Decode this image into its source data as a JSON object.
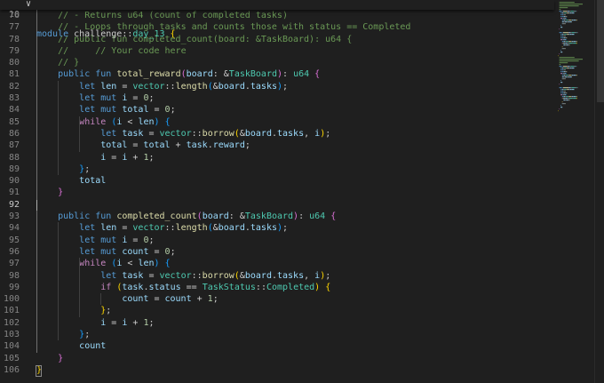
{
  "sticky_scroll": {
    "line_number": "10",
    "tokens": [
      {
        "t": "module",
        "c": "kw"
      },
      {
        "t": " challenge",
        "c": "p"
      },
      {
        "t": "::",
        "c": "p"
      },
      {
        "t": "day_13",
        "c": "ty"
      },
      {
        "t": " ",
        "c": "p"
      },
      {
        "t": "{",
        "c": "b1"
      }
    ]
  },
  "lines": [
    {
      "n": "76",
      "i": 1,
      "tokens": [
        {
          "t": "// - Returns u64 (count of completed tasks)",
          "c": "com"
        }
      ]
    },
    {
      "n": "77",
      "i": 1,
      "tokens": [
        {
          "t": "// - Loops through tasks and counts those with status == Completed",
          "c": "com"
        }
      ]
    },
    {
      "n": "78",
      "i": 1,
      "tokens": [
        {
          "t": "// public fun completed_count(board: &TaskBoard): u64 {",
          "c": "com"
        }
      ]
    },
    {
      "n": "79",
      "i": 1,
      "tokens": [
        {
          "t": "//     // Your code here",
          "c": "com"
        }
      ]
    },
    {
      "n": "80",
      "i": 1,
      "tokens": [
        {
          "t": "// }",
          "c": "com"
        }
      ]
    },
    {
      "n": "81",
      "i": 1,
      "tokens": [
        {
          "t": "public",
          "c": "kw"
        },
        {
          "t": " ",
          "c": "p"
        },
        {
          "t": "fun",
          "c": "kw"
        },
        {
          "t": " ",
          "c": "p"
        },
        {
          "t": "total_reward",
          "c": "fn"
        },
        {
          "t": "(",
          "c": "b2"
        },
        {
          "t": "board",
          "c": "var"
        },
        {
          "t": ": &",
          "c": "p"
        },
        {
          "t": "TaskBoard",
          "c": "ty"
        },
        {
          "t": ")",
          "c": "b2"
        },
        {
          "t": ": ",
          "c": "p"
        },
        {
          "t": "u64",
          "c": "ty"
        },
        {
          "t": " ",
          "c": "p"
        },
        {
          "t": "{",
          "c": "b2"
        }
      ]
    },
    {
      "n": "82",
      "i": 2,
      "tokens": [
        {
          "t": "let",
          "c": "kw"
        },
        {
          "t": " ",
          "c": "p"
        },
        {
          "t": "len",
          "c": "var"
        },
        {
          "t": " = ",
          "c": "p"
        },
        {
          "t": "vector",
          "c": "ty"
        },
        {
          "t": "::",
          "c": "p"
        },
        {
          "t": "length",
          "c": "fn"
        },
        {
          "t": "(",
          "c": "b3"
        },
        {
          "t": "&",
          "c": "p"
        },
        {
          "t": "board",
          "c": "var"
        },
        {
          "t": ".",
          "c": "p"
        },
        {
          "t": "tasks",
          "c": "var"
        },
        {
          "t": ")",
          "c": "b3"
        },
        {
          "t": ";",
          "c": "p"
        }
      ]
    },
    {
      "n": "83",
      "i": 2,
      "tokens": [
        {
          "t": "let",
          "c": "kw"
        },
        {
          "t": " ",
          "c": "p"
        },
        {
          "t": "mut",
          "c": "kw"
        },
        {
          "t": " ",
          "c": "p"
        },
        {
          "t": "i",
          "c": "var"
        },
        {
          "t": " = ",
          "c": "p"
        },
        {
          "t": "0",
          "c": "num"
        },
        {
          "t": ";",
          "c": "p"
        }
      ]
    },
    {
      "n": "84",
      "i": 2,
      "tokens": [
        {
          "t": "let",
          "c": "kw"
        },
        {
          "t": " ",
          "c": "p"
        },
        {
          "t": "mut",
          "c": "kw"
        },
        {
          "t": " ",
          "c": "p"
        },
        {
          "t": "total",
          "c": "var"
        },
        {
          "t": " = ",
          "c": "p"
        },
        {
          "t": "0",
          "c": "num"
        },
        {
          "t": ";",
          "c": "p"
        }
      ]
    },
    {
      "n": "85",
      "i": 2,
      "tokens": [
        {
          "t": "while",
          "c": "kw-ctrl"
        },
        {
          "t": " ",
          "c": "p"
        },
        {
          "t": "(",
          "c": "b3"
        },
        {
          "t": "i",
          "c": "var"
        },
        {
          "t": " < ",
          "c": "p"
        },
        {
          "t": "len",
          "c": "var"
        },
        {
          "t": ")",
          "c": "b3"
        },
        {
          "t": " ",
          "c": "p"
        },
        {
          "t": "{",
          "c": "b3"
        }
      ]
    },
    {
      "n": "86",
      "i": 3,
      "tokens": [
        {
          "t": "let",
          "c": "kw"
        },
        {
          "t": " ",
          "c": "p"
        },
        {
          "t": "task",
          "c": "var"
        },
        {
          "t": " = ",
          "c": "p"
        },
        {
          "t": "vector",
          "c": "ty"
        },
        {
          "t": "::",
          "c": "p"
        },
        {
          "t": "borrow",
          "c": "fn"
        },
        {
          "t": "(",
          "c": "b1"
        },
        {
          "t": "&",
          "c": "p"
        },
        {
          "t": "board",
          "c": "var"
        },
        {
          "t": ".",
          "c": "p"
        },
        {
          "t": "tasks",
          "c": "var"
        },
        {
          "t": ", ",
          "c": "p"
        },
        {
          "t": "i",
          "c": "var"
        },
        {
          "t": ")",
          "c": "b1"
        },
        {
          "t": ";",
          "c": "p"
        }
      ]
    },
    {
      "n": "87",
      "i": 3,
      "tokens": [
        {
          "t": "total",
          "c": "var"
        },
        {
          "t": " = ",
          "c": "p"
        },
        {
          "t": "total",
          "c": "var"
        },
        {
          "t": " + ",
          "c": "p"
        },
        {
          "t": "task",
          "c": "var"
        },
        {
          "t": ".",
          "c": "p"
        },
        {
          "t": "reward",
          "c": "var"
        },
        {
          "t": ";",
          "c": "p"
        }
      ]
    },
    {
      "n": "88",
      "i": 3,
      "tokens": [
        {
          "t": "i",
          "c": "var"
        },
        {
          "t": " = ",
          "c": "p"
        },
        {
          "t": "i",
          "c": "var"
        },
        {
          "t": " + ",
          "c": "p"
        },
        {
          "t": "1",
          "c": "num"
        },
        {
          "t": ";",
          "c": "p"
        }
      ]
    },
    {
      "n": "89",
      "i": 2,
      "tokens": [
        {
          "t": "}",
          "c": "b3"
        },
        {
          "t": ";",
          "c": "p"
        }
      ]
    },
    {
      "n": "90",
      "i": 2,
      "tokens": [
        {
          "t": "total",
          "c": "var"
        }
      ]
    },
    {
      "n": "91",
      "i": 1,
      "tokens": [
        {
          "t": "}",
          "c": "b2"
        }
      ]
    },
    {
      "n": "92",
      "i": 0,
      "current": true,
      "tokens": []
    },
    {
      "n": "93",
      "i": 1,
      "tokens": [
        {
          "t": "public",
          "c": "kw"
        },
        {
          "t": " ",
          "c": "p"
        },
        {
          "t": "fun",
          "c": "kw"
        },
        {
          "t": " ",
          "c": "p"
        },
        {
          "t": "completed_count",
          "c": "fn"
        },
        {
          "t": "(",
          "c": "b2"
        },
        {
          "t": "board",
          "c": "var"
        },
        {
          "t": ": &",
          "c": "p"
        },
        {
          "t": "TaskBoard",
          "c": "ty"
        },
        {
          "t": ")",
          "c": "b2"
        },
        {
          "t": ": ",
          "c": "p"
        },
        {
          "t": "u64",
          "c": "ty"
        },
        {
          "t": " ",
          "c": "p"
        },
        {
          "t": "{",
          "c": "b2"
        }
      ]
    },
    {
      "n": "94",
      "i": 2,
      "tokens": [
        {
          "t": "let",
          "c": "kw"
        },
        {
          "t": " ",
          "c": "p"
        },
        {
          "t": "len",
          "c": "var"
        },
        {
          "t": " = ",
          "c": "p"
        },
        {
          "t": "vector",
          "c": "ty"
        },
        {
          "t": "::",
          "c": "p"
        },
        {
          "t": "length",
          "c": "fn"
        },
        {
          "t": "(",
          "c": "b3"
        },
        {
          "t": "&",
          "c": "p"
        },
        {
          "t": "board",
          "c": "var"
        },
        {
          "t": ".",
          "c": "p"
        },
        {
          "t": "tasks",
          "c": "var"
        },
        {
          "t": ")",
          "c": "b3"
        },
        {
          "t": ";",
          "c": "p"
        }
      ]
    },
    {
      "n": "95",
      "i": 2,
      "tokens": [
        {
          "t": "let",
          "c": "kw"
        },
        {
          "t": " ",
          "c": "p"
        },
        {
          "t": "mut",
          "c": "kw"
        },
        {
          "t": " ",
          "c": "p"
        },
        {
          "t": "i",
          "c": "var"
        },
        {
          "t": " = ",
          "c": "p"
        },
        {
          "t": "0",
          "c": "num"
        },
        {
          "t": ";",
          "c": "p"
        }
      ]
    },
    {
      "n": "96",
      "i": 2,
      "tokens": [
        {
          "t": "let",
          "c": "kw"
        },
        {
          "t": " ",
          "c": "p"
        },
        {
          "t": "mut",
          "c": "kw"
        },
        {
          "t": " ",
          "c": "p"
        },
        {
          "t": "count",
          "c": "var"
        },
        {
          "t": " = ",
          "c": "p"
        },
        {
          "t": "0",
          "c": "num"
        },
        {
          "t": ";",
          "c": "p"
        }
      ]
    },
    {
      "n": "97",
      "i": 2,
      "tokens": [
        {
          "t": "while",
          "c": "kw-ctrl"
        },
        {
          "t": " ",
          "c": "p"
        },
        {
          "t": "(",
          "c": "b3"
        },
        {
          "t": "i",
          "c": "var"
        },
        {
          "t": " < ",
          "c": "p"
        },
        {
          "t": "len",
          "c": "var"
        },
        {
          "t": ")",
          "c": "b3"
        },
        {
          "t": " ",
          "c": "p"
        },
        {
          "t": "{",
          "c": "b3"
        }
      ]
    },
    {
      "n": "98",
      "i": 3,
      "tokens": [
        {
          "t": "let",
          "c": "kw"
        },
        {
          "t": " ",
          "c": "p"
        },
        {
          "t": "task",
          "c": "var"
        },
        {
          "t": " = ",
          "c": "p"
        },
        {
          "t": "vector",
          "c": "ty"
        },
        {
          "t": "::",
          "c": "p"
        },
        {
          "t": "borrow",
          "c": "fn"
        },
        {
          "t": "(",
          "c": "b1"
        },
        {
          "t": "&",
          "c": "p"
        },
        {
          "t": "board",
          "c": "var"
        },
        {
          "t": ".",
          "c": "p"
        },
        {
          "t": "tasks",
          "c": "var"
        },
        {
          "t": ", ",
          "c": "p"
        },
        {
          "t": "i",
          "c": "var"
        },
        {
          "t": ")",
          "c": "b1"
        },
        {
          "t": ";",
          "c": "p"
        }
      ]
    },
    {
      "n": "99",
      "i": 3,
      "tokens": [
        {
          "t": "if",
          "c": "kw-ctrl"
        },
        {
          "t": " ",
          "c": "p"
        },
        {
          "t": "(",
          "c": "b1"
        },
        {
          "t": "task",
          "c": "var"
        },
        {
          "t": ".",
          "c": "p"
        },
        {
          "t": "status",
          "c": "var"
        },
        {
          "t": " == ",
          "c": "p"
        },
        {
          "t": "TaskStatus",
          "c": "ty"
        },
        {
          "t": "::",
          "c": "p"
        },
        {
          "t": "Completed",
          "c": "ty"
        },
        {
          "t": ")",
          "c": "b1"
        },
        {
          "t": " ",
          "c": "p"
        },
        {
          "t": "{",
          "c": "b1"
        }
      ]
    },
    {
      "n": "100",
      "i": 4,
      "tokens": [
        {
          "t": "count",
          "c": "var"
        },
        {
          "t": " = ",
          "c": "p"
        },
        {
          "t": "count",
          "c": "var"
        },
        {
          "t": " + ",
          "c": "p"
        },
        {
          "t": "1",
          "c": "num"
        },
        {
          "t": ";",
          "c": "p"
        }
      ]
    },
    {
      "n": "101",
      "i": 3,
      "tokens": [
        {
          "t": "}",
          "c": "b1"
        },
        {
          "t": ";",
          "c": "p"
        }
      ]
    },
    {
      "n": "102",
      "i": 3,
      "tokens": [
        {
          "t": "i",
          "c": "var"
        },
        {
          "t": " = ",
          "c": "p"
        },
        {
          "t": "i",
          "c": "var"
        },
        {
          "t": " + ",
          "c": "p"
        },
        {
          "t": "1",
          "c": "num"
        },
        {
          "t": ";",
          "c": "p"
        }
      ]
    },
    {
      "n": "103",
      "i": 2,
      "tokens": [
        {
          "t": "}",
          "c": "b3"
        },
        {
          "t": ";",
          "c": "p"
        }
      ]
    },
    {
      "n": "104",
      "i": 2,
      "tokens": [
        {
          "t": "count",
          "c": "var"
        }
      ]
    },
    {
      "n": "105",
      "i": 1,
      "tokens": [
        {
          "t": "}",
          "c": "b2"
        }
      ]
    },
    {
      "n": "106",
      "i": 0,
      "tokens": [
        {
          "t": "}",
          "c": "b1"
        }
      ]
    }
  ],
  "icons": {
    "fold": "chevron-down-icon"
  },
  "colors": {
    "background": "#1f1f1f",
    "keyword": "#569cd6",
    "control_keyword": "#c586c0",
    "type": "#4ec9b0",
    "function": "#dcdcaa",
    "variable": "#9cdcfe",
    "number": "#b5cea8",
    "comment": "#6a9955"
  }
}
